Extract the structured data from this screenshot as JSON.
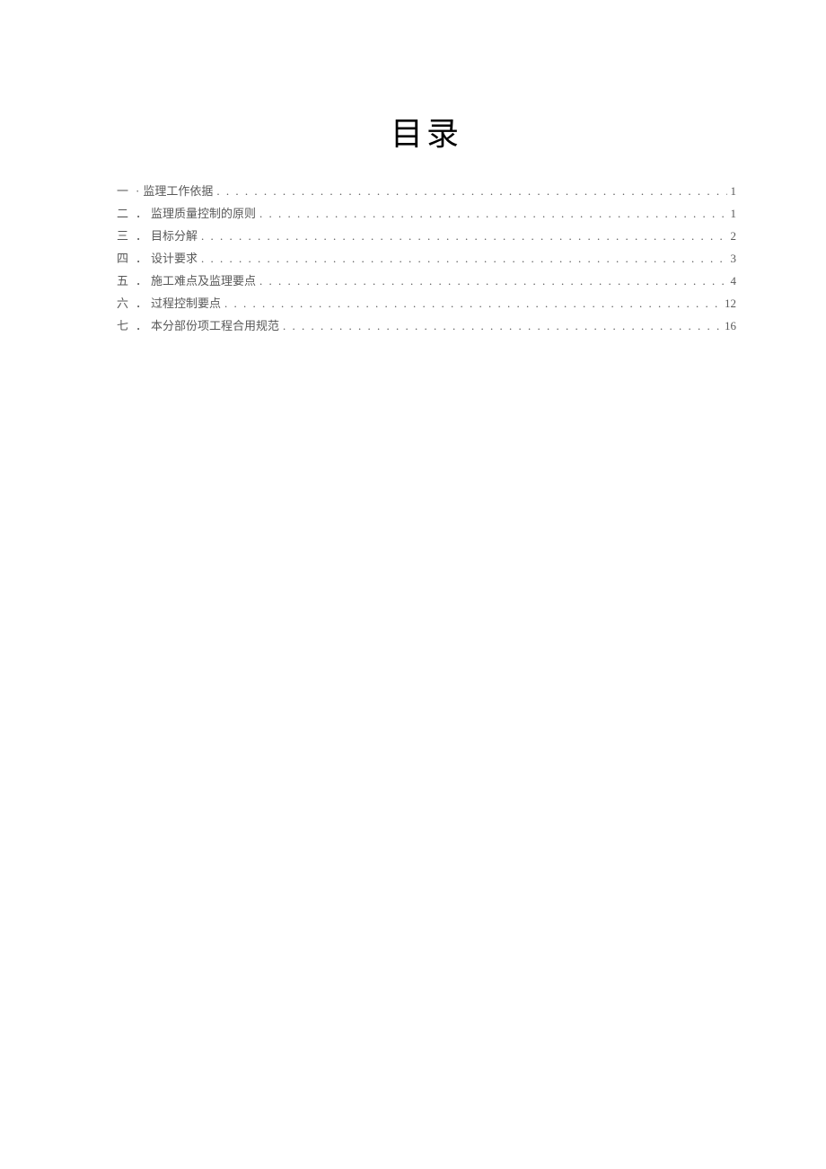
{
  "heading": "目录",
  "toc": [
    {
      "num": "一",
      "sep": "·",
      "label": "监理工作依据",
      "page": "1"
    },
    {
      "num": "二",
      "sep": "．",
      "label": "监理质量控制的原则",
      "page": "1"
    },
    {
      "num": "三",
      "sep": "．",
      "label": "目标分解",
      "page": "2"
    },
    {
      "num": "四",
      "sep": "．",
      "label": "设计要求",
      "page": "3"
    },
    {
      "num": "五",
      "sep": "．",
      "label": "施工难点及监理要点",
      "page": "4"
    },
    {
      "num": "六",
      "sep": "．",
      "label": "过程控制要点",
      "page": "12"
    },
    {
      "num": "七",
      "sep": "．",
      "label": "本分部份项工程合用规范",
      "page": "16"
    }
  ]
}
